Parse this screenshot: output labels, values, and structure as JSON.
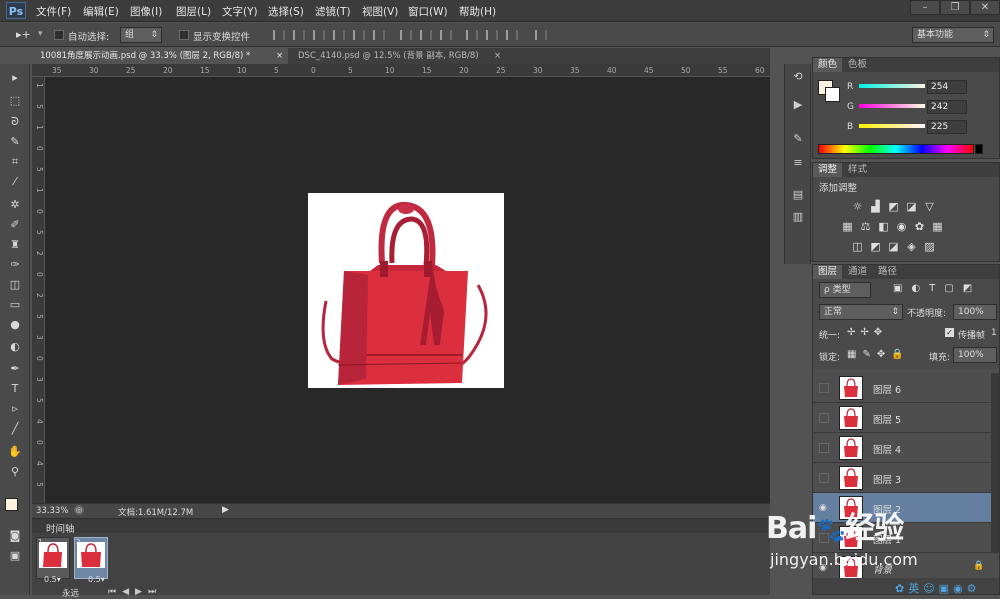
{
  "app": {
    "logo": "Ps"
  },
  "menu": [
    "文件(F)",
    "编辑(E)",
    "图像(I)",
    "图层(L)",
    "文字(Y)",
    "选择(S)",
    "滤镜(T)",
    "视图(V)",
    "窗口(W)",
    "帮助(H)"
  ],
  "window_controls": [
    "minimize-icon",
    "restore-icon",
    "close-icon"
  ],
  "options": {
    "auto_select_label": "自动选择:",
    "auto_select_value": "组",
    "show_transform_label": "显示变换控件",
    "workspace": "基本功能"
  },
  "tabs": [
    {
      "label": "10081角度展示动画.psd @ 33.3% (图层 2, RGB/8) *",
      "close": "×",
      "active": true
    },
    {
      "label": "DSC_4140.psd @ 12.5% (背景 副本, RGB/8)",
      "close": "×",
      "active": false
    }
  ],
  "ruler_h": [
    "35",
    "30",
    "25",
    "20",
    "15",
    "10",
    "5",
    "0",
    "5",
    "10",
    "15",
    "20",
    "25",
    "30",
    "35",
    "40",
    "45",
    "50",
    "55",
    "60"
  ],
  "ruler_v": [
    "1",
    "5",
    "1",
    "0",
    "5",
    "1",
    "0",
    "5",
    "2",
    "0",
    "2",
    "5",
    "3",
    "0",
    "3",
    "5",
    "4",
    "0",
    "4",
    "5"
  ],
  "status": {
    "zoom": "33.33%",
    "doc": "文档:1.61M/12.7M"
  },
  "timeline": {
    "title": "时间轴",
    "frames": [
      {
        "num": "1",
        "delay": "0.5▾",
        "selected": false
      },
      {
        "num": "2",
        "delay": "0.5▾",
        "selected": true
      }
    ],
    "loop": "永远"
  },
  "color_panel": {
    "tabs": [
      "颜色",
      "色板"
    ],
    "r_label": "R",
    "g_label": "G",
    "b_label": "B",
    "r": "254",
    "g": "242",
    "b": "225",
    "fg_color": "#fef2e1"
  },
  "adjust_panel": {
    "tabs": [
      "调整",
      "样式"
    ],
    "title": "添加调整"
  },
  "layers_panel": {
    "tabs": [
      "图层",
      "通道",
      "路径"
    ],
    "filter": "ρ 类型",
    "blend": "正常",
    "opacity_label": "不透明度:",
    "opacity": "100%",
    "unify_label": "统一:",
    "propagate_label": "传播帧",
    "propagate_num": "1",
    "lock_label": "锁定:",
    "fill_label": "填充:",
    "fill": "100%",
    "layers": [
      {
        "name": "图层 6",
        "visible": false,
        "selected": false
      },
      {
        "name": "图层 5",
        "visible": false,
        "selected": false
      },
      {
        "name": "图层 4",
        "visible": false,
        "selected": false
      },
      {
        "name": "图层 3",
        "visible": false,
        "selected": false
      },
      {
        "name": "图层 2",
        "visible": true,
        "selected": true
      },
      {
        "name": "图层 1",
        "visible": false,
        "selected": false
      },
      {
        "name": "背景",
        "visible": true,
        "selected": false
      }
    ]
  },
  "watermark": {
    "brand": "Bai",
    "brand2": "经验",
    "url": "jingyan.baidu.com"
  },
  "accent": "#dc2f3e"
}
